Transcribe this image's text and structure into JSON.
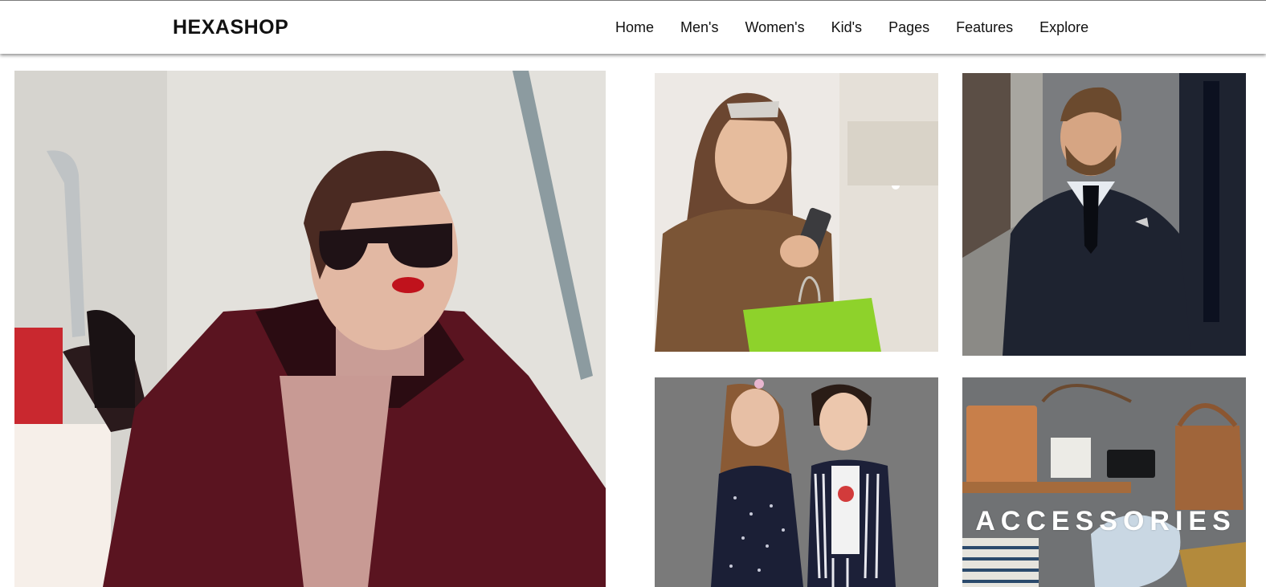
{
  "header": {
    "logo": "HEXASHOP",
    "nav": [
      "Home",
      "Men's",
      "Women's",
      "Kid's",
      "Pages",
      "Features",
      "Explore"
    ]
  },
  "tiles": {
    "accessories_label": "ACCESSORIES"
  },
  "colors": {
    "text": "#111111",
    "header_bg": "#ffffff",
    "coat": "#5a1420",
    "bag_green": "#8ed22b",
    "suit": "#1e2330"
  }
}
